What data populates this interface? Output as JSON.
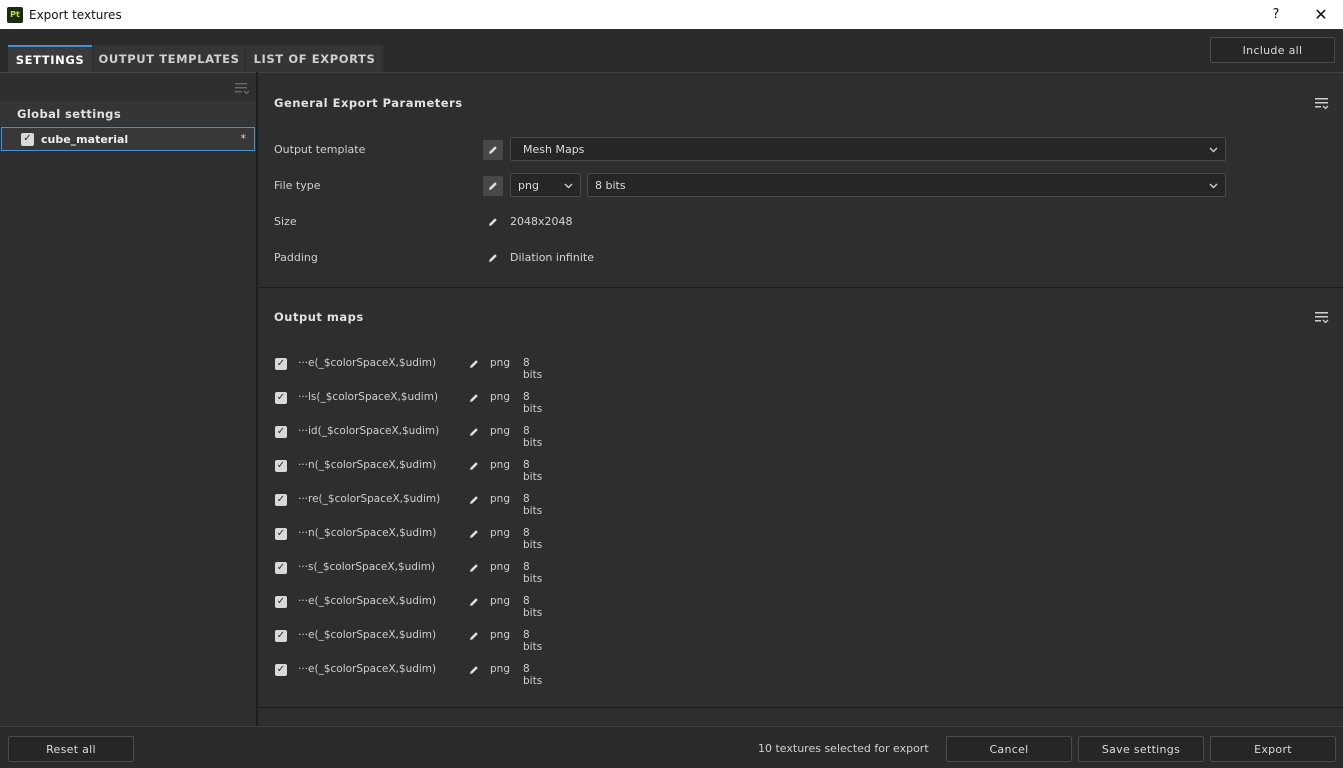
{
  "window": {
    "app_icon_text": "Pt",
    "title": "Export textures",
    "help_glyph": "?",
    "close_glyph": "✕"
  },
  "tabs": [
    {
      "label": "SETTINGS",
      "active": true
    },
    {
      "label": "OUTPUT TEMPLATES",
      "active": false
    },
    {
      "label": "LIST OF EXPORTS",
      "active": false
    }
  ],
  "include_all_label": "Include all",
  "sidebar": {
    "global_settings_label": "Global settings",
    "materials": [
      {
        "name": "cube_material",
        "checked": true,
        "modified_marker": "*"
      }
    ]
  },
  "general": {
    "title": "General Export Parameters",
    "output_template": {
      "label": "Output template",
      "value": "Mesh Maps"
    },
    "file_type": {
      "label": "File type",
      "format": "png",
      "bit_depth": "8 bits"
    },
    "size": {
      "label": "Size",
      "value": "2048x2048"
    },
    "padding": {
      "label": "Padding",
      "value": "Dilation infinite"
    }
  },
  "output_maps": {
    "title": "Output maps",
    "maps": [
      {
        "name": "···e(_$colorSpaceX,$udim)",
        "format": "png",
        "bits": "8 bits",
        "checked": true
      },
      {
        "name": "···ls(_$colorSpaceX,$udim)",
        "format": "png",
        "bits": "8 bits",
        "checked": true
      },
      {
        "name": "···id(_$colorSpaceX,$udim)",
        "format": "png",
        "bits": "8 bits",
        "checked": true
      },
      {
        "name": "···n(_$colorSpaceX,$udim)",
        "format": "png",
        "bits": "8 bits",
        "checked": true
      },
      {
        "name": "···re(_$colorSpaceX,$udim)",
        "format": "png",
        "bits": "8 bits",
        "checked": true
      },
      {
        "name": "···n(_$colorSpaceX,$udim)",
        "format": "png",
        "bits": "8 bits",
        "checked": true
      },
      {
        "name": "···s(_$colorSpaceX,$udim)",
        "format": "png",
        "bits": "8 bits",
        "checked": true
      },
      {
        "name": "···e(_$colorSpaceX,$udim)",
        "format": "png",
        "bits": "8 bits",
        "checked": true
      },
      {
        "name": "···e(_$colorSpaceX,$udim)",
        "format": "png",
        "bits": "8 bits",
        "checked": true
      },
      {
        "name": "···e(_$colorSpaceX,$udim)",
        "format": "png",
        "bits": "8 bits",
        "checked": true
      }
    ]
  },
  "footer": {
    "reset_label": "Reset all",
    "status": "10 textures selected for export",
    "cancel_label": "Cancel",
    "save_label": "Save settings",
    "export_label": "Export"
  },
  "colors": {
    "accent": "#4a90d9",
    "background": "#2e2e2e",
    "app_icon_bg": "#1d2b10",
    "app_icon_fg": "#b7e05a"
  }
}
